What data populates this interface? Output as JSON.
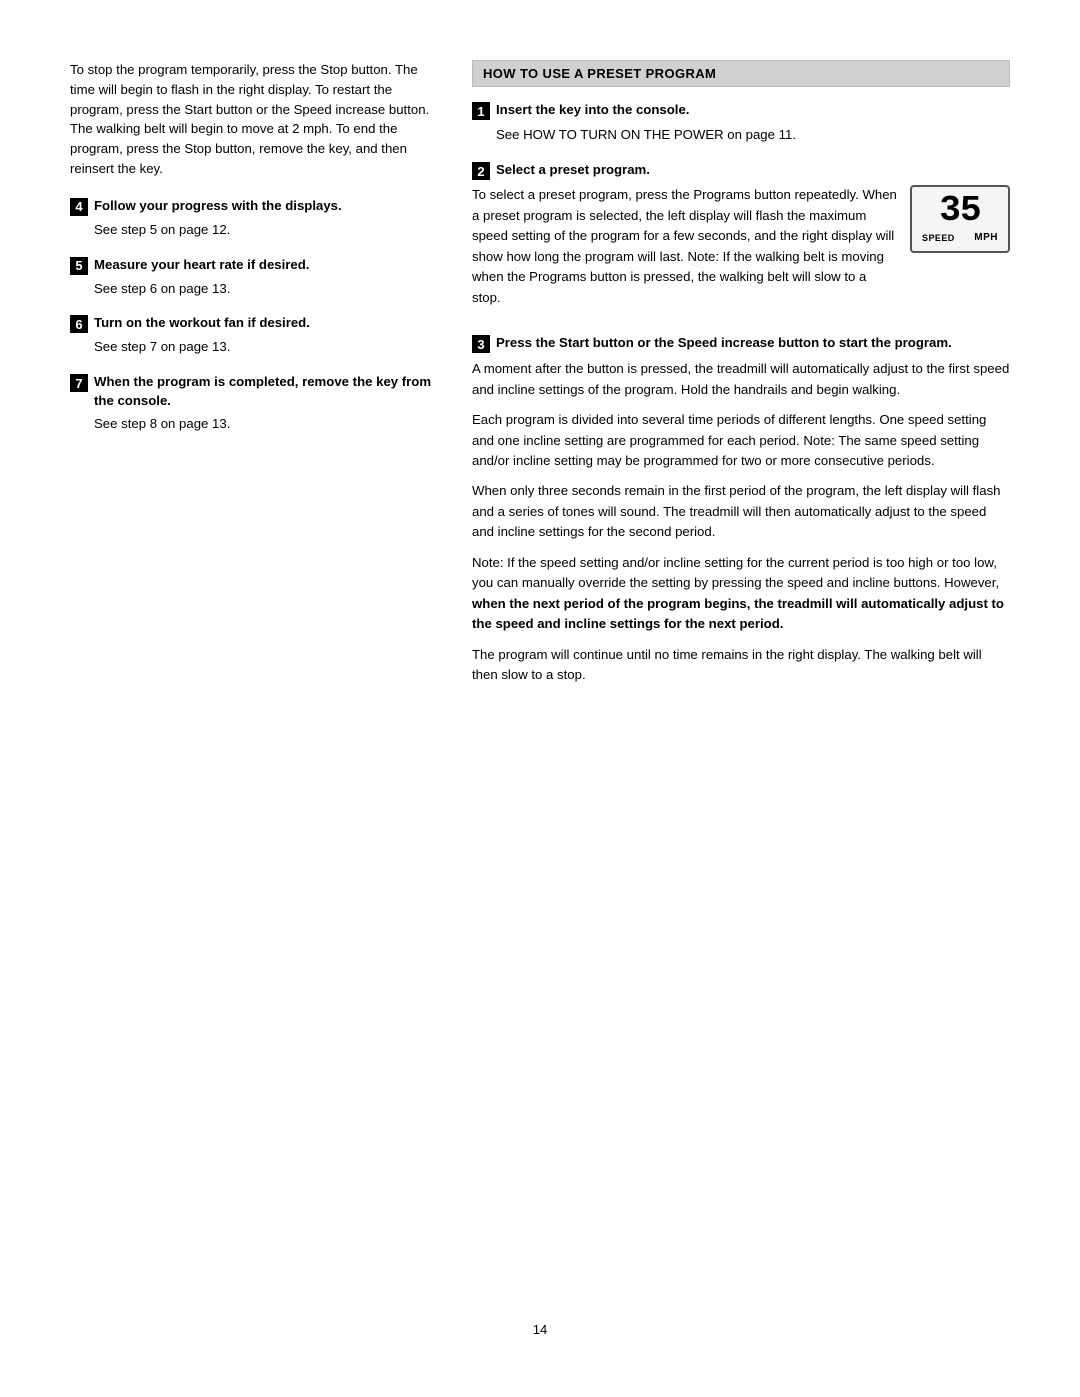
{
  "page": {
    "number": "14"
  },
  "left_col": {
    "intro": "To stop the program temporarily, press the Stop button. The time will begin to flash in the right display. To restart the program, press the Start button or the Speed increase button. The walking belt will begin to move at 2 mph. To end the program, press the Stop button, remove the key, and then reinsert the key.",
    "steps": [
      {
        "number": "4",
        "title": "Follow your progress with the displays.",
        "body": "See step 5 on page 12."
      },
      {
        "number": "5",
        "title": "Measure your heart rate if desired.",
        "body": "See step 6 on page 13."
      },
      {
        "number": "6",
        "title": "Turn on the workout fan if desired.",
        "body": "See step 7 on page 13."
      },
      {
        "number": "7",
        "title": "When the program is completed, remove the key from the console.",
        "body": "See step 8 on page 13."
      }
    ]
  },
  "right_col": {
    "section_title": "HOW TO USE A PRESET PROGRAM",
    "steps": [
      {
        "number": "1",
        "title": "Insert the key into the console.",
        "body": "See HOW TO TURN ON THE POWER on page 11."
      },
      {
        "number": "2",
        "title": "Select a preset program.",
        "body_parts": [
          "To select a preset program, press the Programs button repeatedly. When a preset program is selected, the left display will flash the maximum speed setting of the program for a few seconds, and the right display will show how long the program will last. Note: If the walking belt is moving when the Programs button is pressed, the walking belt will slow to a stop."
        ],
        "speed_display": {
          "value": "35",
          "label_left": "SPEED",
          "label_right": "MPH"
        }
      },
      {
        "number": "3",
        "title": "Press the Start button or the Speed increase button to start the program.",
        "paragraphs": [
          "A moment after the button is pressed, the treadmill will automatically adjust to the first speed and incline settings of the program. Hold the handrails and begin walking.",
          "Each program is divided into several time periods of different lengths. One speed setting and one incline setting are programmed for each period. Note: The same speed setting and/or incline setting may be programmed for two or more consecutive periods.",
          "When only three seconds remain in the first period of the program, the left display will flash and a series of tones will sound. The treadmill will then automatically adjust to the speed and incline settings for the second period.",
          "Note: If the speed setting and/or incline setting for the current period is too high or too low, you can manually override the setting by pressing the speed and incline buttons. However,",
          "when the next period of the program begins, the treadmill will automatically adjust to the speed and incline settings for the next period.",
          "The program will continue until no time remains in the right display. The walking belt will then slow to a stop."
        ],
        "bold_segment": "when the next period of the program begins, the treadmill will automatically adjust to the speed and incline settings for the next period."
      }
    ]
  }
}
